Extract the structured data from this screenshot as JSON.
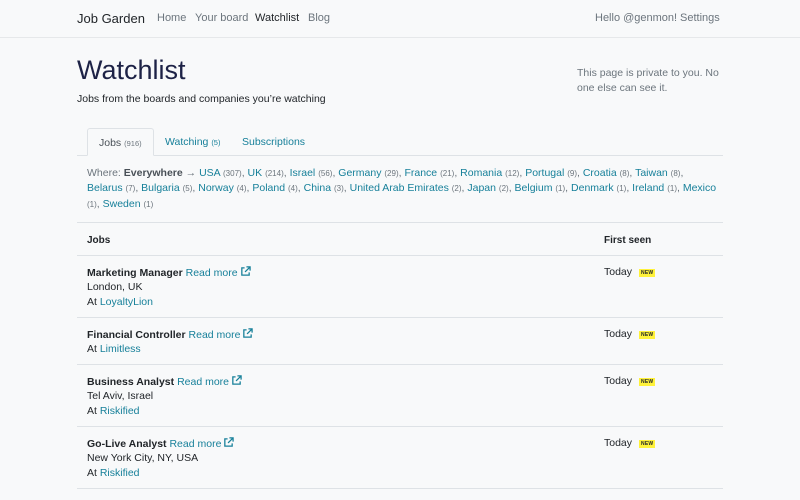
{
  "nav": {
    "brand": "Job Garden",
    "links": [
      "Home",
      "Your board",
      "Watchlist",
      "Blog"
    ],
    "greeting": "Hello @genmon!",
    "settings": "Settings"
  },
  "header": {
    "title": "Watchlist",
    "subtitle": "Jobs from the boards and companies you’re watching",
    "private_note": "This page is private to you. No one else can see it."
  },
  "tabs": [
    {
      "label": "Jobs",
      "count": "(916)"
    },
    {
      "label": "Watching",
      "count": "(5)"
    },
    {
      "label": "Subscriptions",
      "count": ""
    }
  ],
  "where": {
    "label": "Where:",
    "current": "Everywhere",
    "arrow": "→",
    "locations": [
      {
        "name": "USA",
        "count": "(307)"
      },
      {
        "name": "UK",
        "count": "(214)"
      },
      {
        "name": "Israel",
        "count": "(56)"
      },
      {
        "name": "Germany",
        "count": "(29)"
      },
      {
        "name": "France",
        "count": "(21)"
      },
      {
        "name": "Romania",
        "count": "(12)"
      },
      {
        "name": "Portugal",
        "count": "(9)"
      },
      {
        "name": "Croatia",
        "count": "(8)"
      },
      {
        "name": "Taiwan",
        "count": "(8)"
      },
      {
        "name": "Belarus",
        "count": "(7)"
      },
      {
        "name": "Bulgaria",
        "count": "(5)"
      },
      {
        "name": "Norway",
        "count": "(4)"
      },
      {
        "name": "Poland",
        "count": "(4)"
      },
      {
        "name": "China",
        "count": "(3)"
      },
      {
        "name": "United Arab Emirates",
        "count": "(2)"
      },
      {
        "name": "Japan",
        "count": "(2)"
      },
      {
        "name": "Belgium",
        "count": "(1)"
      },
      {
        "name": "Denmark",
        "count": "(1)"
      },
      {
        "name": "Ireland",
        "count": "(1)"
      },
      {
        "name": "Mexico",
        "count": "(1)"
      },
      {
        "name": "Sweden",
        "count": "(1)"
      }
    ]
  },
  "table": {
    "col_jobs": "Jobs",
    "col_seen": "First seen",
    "read_more": "Read more",
    "at": "At",
    "new_badge": "NEW",
    "rows": [
      {
        "title": "Marketing Manager",
        "location": "London, UK",
        "company": "LoyaltyLion",
        "seen": "Today"
      },
      {
        "title": "Financial Controller",
        "location": "",
        "company": "Limitless",
        "seen": "Today"
      },
      {
        "title": "Business Analyst",
        "location": "Tel Aviv, Israel",
        "company": "Riskified",
        "seen": "Today"
      },
      {
        "title": "Go-Live Analyst",
        "location": "New York City, NY, USA",
        "company": "Riskified",
        "seen": "Today"
      }
    ]
  }
}
